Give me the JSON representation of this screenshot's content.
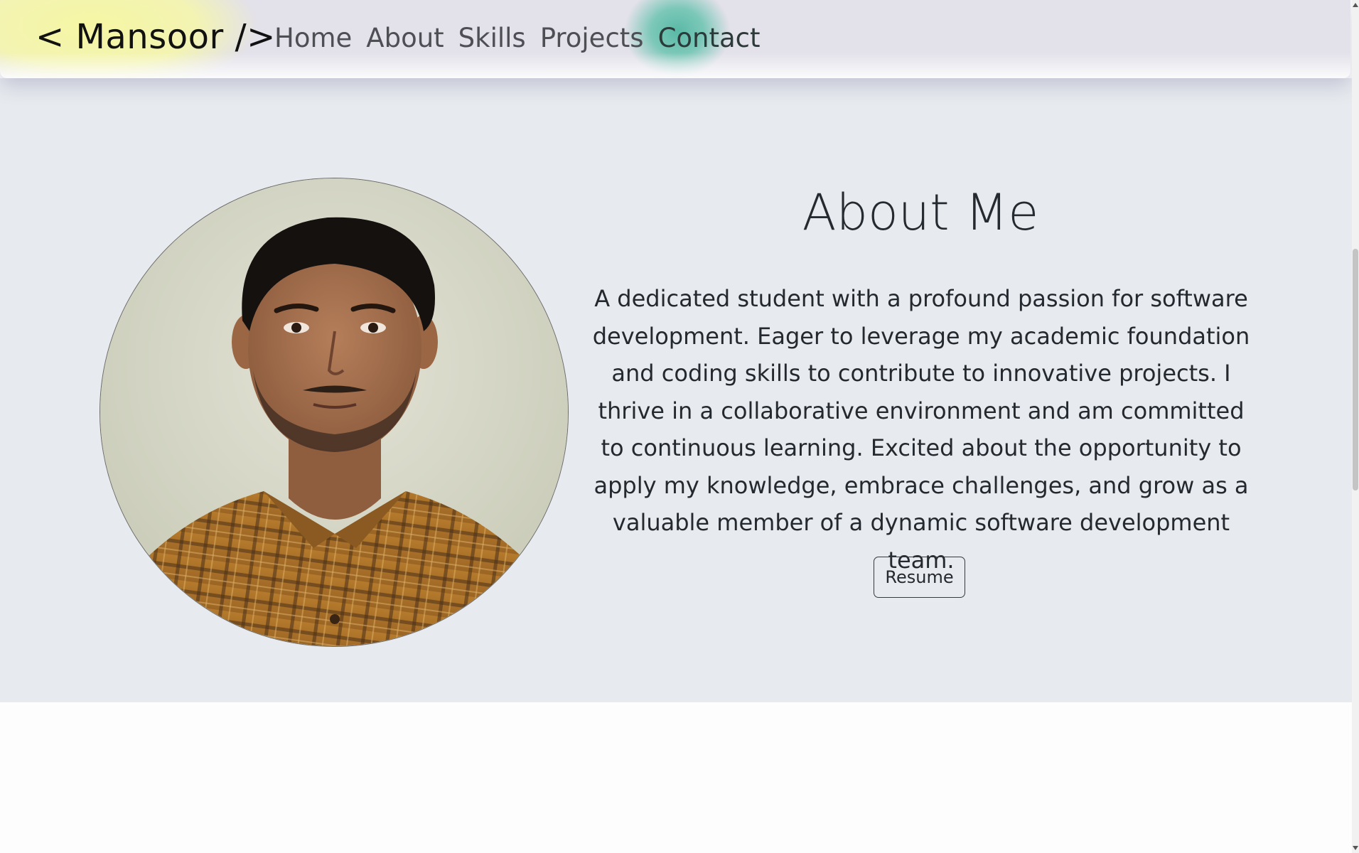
{
  "nav": {
    "brand": "< Mansoor />",
    "links": [
      "Home",
      "About",
      "Skills",
      "Projects",
      "Contact"
    ],
    "active": "Contact"
  },
  "about": {
    "title": "About Me",
    "description": "A dedicated student with a profound passion for software development. Eager to leverage my academic foundation and coding skills to contribute to innovative projects. I thrive in a collaborative environment and am committed to continuous learning. Excited about the opportunity to apply my knowledge, embrace challenges, and grow as a valuable member of a dynamic software development team.",
    "resume_label": "Resume",
    "photo_icon": "profile-photo"
  },
  "colors": {
    "section_bg": "#e7eaee",
    "navbar_bg": "#e3e1ea",
    "highlight_yellow": "#f6f6a4",
    "highlight_teal": "#5ab9a6",
    "text": "#24292f"
  }
}
